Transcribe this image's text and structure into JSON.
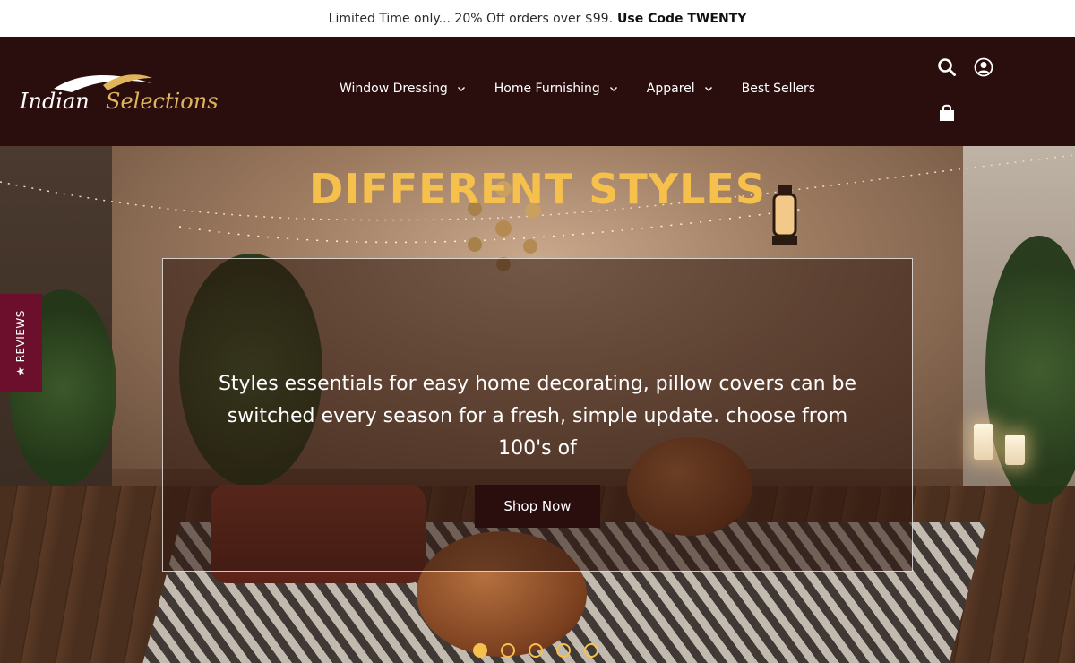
{
  "announcement": {
    "text": "Limited Time only... 20% Off orders over $99.",
    "code": "Use Code TWENTY"
  },
  "header": {
    "logo_text_part1": "Indian",
    "logo_text_part2": "Selections",
    "nav": [
      {
        "label": "Window Dressing",
        "has_dropdown": true
      },
      {
        "label": "Home Furnishing",
        "has_dropdown": true
      },
      {
        "label": "Apparel",
        "has_dropdown": true
      },
      {
        "label": "Best Sellers",
        "has_dropdown": false
      }
    ],
    "icons": [
      "search-icon",
      "account-icon",
      "cart-icon"
    ],
    "background": "#2a0d0d"
  },
  "hero": {
    "headline": "DIFFERENT STYLES",
    "subtext": "Styles essentials for easy home decorating, pillow covers can be switched every season for a fresh, simple update. choose from 100's of",
    "cta_label": "Shop Now",
    "accent": "#f6c04d",
    "slides": 5,
    "active_slide": 1
  },
  "reviews_tab": {
    "label": "★ REVIEWS",
    "color": "#6b0f2c"
  }
}
